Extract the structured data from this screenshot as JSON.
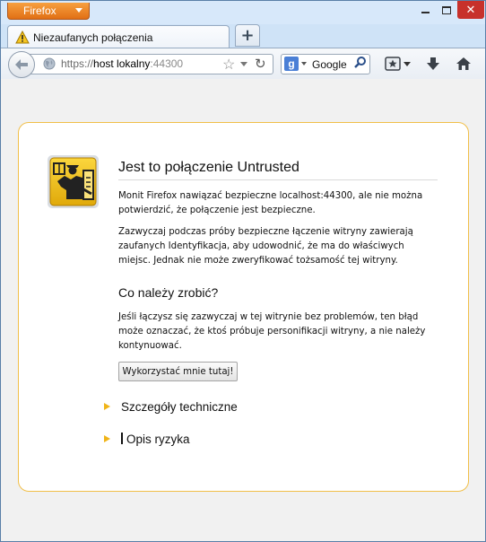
{
  "browser": {
    "menu_button": "Firefox",
    "window_controls": {
      "minimize": "minimize-icon",
      "maximize": "maximize-icon",
      "close": "close-icon"
    }
  },
  "tab": {
    "title": "Niezaufanych połączenia",
    "icon": "warning-icon"
  },
  "new_tab_icon": "plus-icon",
  "urlbar": {
    "prefix": "https://",
    "host": "host lokalny",
    "port": ":44300"
  },
  "search": {
    "engine": "Google"
  },
  "colors": {
    "accent": "#f0b418",
    "card_border": "#f1bf49",
    "firefox_button": "#e8801f",
    "close_button": "#c7312b"
  },
  "page": {
    "heading": "Jest to połączenie Untrusted",
    "para1": "Monit Firefox nawiązać bezpieczne localhost:44300, ale nie można potwierdzić, że połączenie jest bezpieczne.",
    "para2": "Zazwyczaj podczas próby bezpieczne łączenie witryny zawierają zaufanych Identyfikacja, aby udowodnić, że ma do właściwych miejsc. Jednak nie może zweryfikować tożsamość tej witryny.",
    "what_to_do": "Co należy zrobić?",
    "para3": "Jeśli łączysz się zazwyczaj w tej witrynie bez problemów, ten błąd może oznaczać, że ktoś próbuje personifikacji witryny, a nie należy kontynuować.",
    "get_me_out": "Wykorzystać mnie tutaj!",
    "technical_details": "Szczegóły techniczne",
    "risk_description": "Opis ryzyka"
  }
}
